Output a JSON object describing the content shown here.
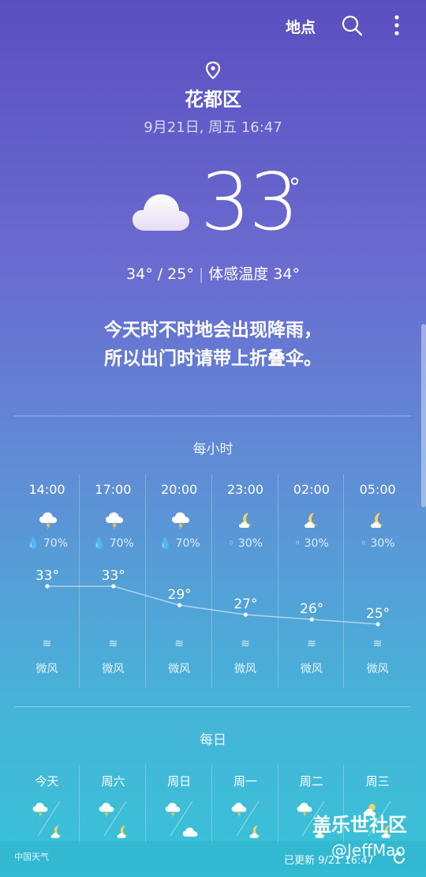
{
  "header": {
    "location_button": "地点"
  },
  "current": {
    "city": "花都区",
    "datetime": "9月21日, 周五 16:47",
    "temperature": "33",
    "degree_symbol": "°",
    "range": "34° / 25°",
    "feels_like": "体感温度 34°",
    "message_line1": "今天时不时地会出现降雨，",
    "message_line2": "所以出门时请带上折叠伞。"
  },
  "hourly": {
    "title": "每小时",
    "items": [
      {
        "time": "14:00",
        "icon": "cloud-thunder-icon",
        "precip": "70%",
        "temp": "33°",
        "temp_value": 33,
        "wind": "微风"
      },
      {
        "time": "17:00",
        "icon": "cloud-thunder-icon",
        "precip": "70%",
        "temp": "33°",
        "temp_value": 33,
        "wind": "微风"
      },
      {
        "time": "20:00",
        "icon": "cloud-thunder-icon",
        "precip": "70%",
        "temp": "29°",
        "temp_value": 29,
        "wind": "微风"
      },
      {
        "time": "23:00",
        "icon": "moon-cloud-icon",
        "precip": "30%",
        "temp": "27°",
        "temp_value": 27,
        "wind": "微风"
      },
      {
        "time": "02:00",
        "icon": "moon-cloud-icon",
        "precip": "30%",
        "temp": "26°",
        "temp_value": 26,
        "wind": "微风"
      },
      {
        "time": "05:00",
        "icon": "moon-cloud-icon",
        "precip": "30%",
        "temp": "25°",
        "temp_value": 25,
        "wind": "微风"
      }
    ]
  },
  "daily": {
    "title": "每日",
    "items": [
      {
        "day": "今天",
        "icon_day": "cloud-thunder-icon",
        "icon_night": "moon-cloud-icon"
      },
      {
        "day": "周六",
        "icon_day": "cloud-thunder-icon",
        "icon_night": "moon-cloud-icon"
      },
      {
        "day": "周日",
        "icon_day": "cloud-thunder-icon",
        "icon_night": "cloud-icon"
      },
      {
        "day": "周一",
        "icon_day": "cloud-thunder-icon",
        "icon_night": "moon-cloud-icon"
      },
      {
        "day": "周二",
        "icon_day": "cloud-thunder-icon",
        "icon_night": "moon-cloud-icon"
      },
      {
        "day": "周三",
        "icon_day": "sun-cloud-icon",
        "icon_night": "moon-cloud-icon"
      }
    ]
  },
  "footer": {
    "logo": "中国天气",
    "updated": "已更新  9/21  16:47"
  },
  "watermark": {
    "line1": "盖乐世社区",
    "line2": "@JeffMao"
  },
  "colors": {
    "bg_top": "#5a4fc0",
    "bg_bottom": "#37c3d8",
    "moon": "#f4d35e",
    "bolt": "#f2c84b"
  }
}
